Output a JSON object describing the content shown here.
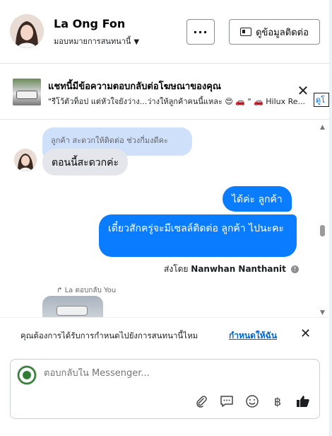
{
  "header": {
    "name": "La Ong Fon",
    "assign_label": "มอบหมายการสนทนานี้",
    "more_label": "···",
    "contact_label": "ดูข้อมูลติดต่อ"
  },
  "ad_banner": {
    "title": "แชทนี้มีข้อความตอบกลับต่อโฆษณาของคุณ",
    "text": "\"รีโว้ตัวท็อป แต่หัวใจยังว่าง...ว่างให้ลูกค้าคนนี้แหละ 😍 🚗 \" 🚗 Hilux Re...",
    "link_label": "ดูโ"
  },
  "messages": {
    "quoted": "ลูกค้า สะดวกให้ติดต่อ ช่วงกี่มงดีคะ",
    "incoming": "ตอนนี้สะดวกค่ะ",
    "outgoing_1": "ได้ค่ะ  ลูกค้า",
    "outgoing_2": "เดี๋ยวสักครู่จะมีเซลล์ติดต่อ ลูกค้า  ไปนะคะ",
    "sent_by_prefix": "ส่งโดย",
    "sent_by_name": "Nanwhan Nanthanit",
    "reply_label": "La ตอบกลับ You"
  },
  "notice": {
    "text": "คุณต้องการได้รับการกำหนดไปยังการสนทนานี้ไหม",
    "link": "กำหนดให้ฉัน"
  },
  "composer": {
    "placeholder": "ตอบกลับใน Messenger..."
  },
  "colors": {
    "outgoing_bubble": "#0a7cff",
    "quote_bubble": "#cfe0fb",
    "incoming_bubble": "#e4e6eb",
    "link": "#0064d1"
  },
  "icons": [
    "avatar",
    "caret-down-icon",
    "more-icon",
    "contact-card-icon",
    "close-icon",
    "info-icon",
    "reply-icon",
    "attach-icon",
    "saved-reply-icon",
    "emoji-icon",
    "baht-icon",
    "like-icon"
  ]
}
